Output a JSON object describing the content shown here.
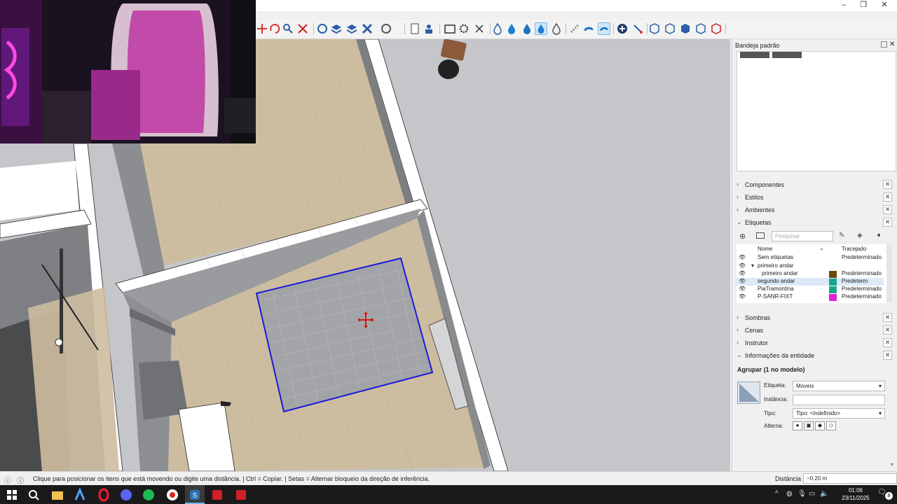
{
  "window": {
    "minimize": "–",
    "restore": "❐",
    "close": "✕"
  },
  "toolbar": {
    "icons": [
      "move-icon",
      "rotate-icon",
      "zoom-icon",
      "zoom-extents-icon",
      "section-icon",
      "layers-icon",
      "styles-icon",
      "scenes-icon",
      "geo-icon",
      "new-icon",
      "user-icon",
      "folder-icon",
      "gear-icon",
      "close-icon",
      "water-drop-icon",
      "water-drop-icon",
      "water-drop-icon",
      "water-drop-icon",
      "water-drop-icon",
      "magnet-icon",
      "magnet-icon",
      "magnet-icon",
      "add-icon",
      "connect-icon",
      "cube-icon",
      "cube-icon",
      "cube-icon",
      "cube-icon",
      "cube-icon",
      "cube-icon",
      "arrows-icon",
      "refresh-icon",
      "grid-icon",
      "grid-icon",
      "grid-icon"
    ]
  },
  "panel": {
    "title": "Bandeja padrão",
    "sections_top": [
      "Componentes",
      "Estilos",
      "Ambientes",
      "Etiquetas"
    ],
    "search_placeholder": "Pesquisar",
    "col_name": "Nome",
    "col_trace": "Tracejado",
    "tags": [
      {
        "name": "Sem etiquetas",
        "trace": "Predeterminado",
        "color": "",
        "indent": 0
      },
      {
        "name": "primeiro andar",
        "trace": "",
        "color": "",
        "indent": 1,
        "toggle": "▾"
      },
      {
        "name": "primeiro andar",
        "trace": "Predeterminado",
        "color": "#6b4a12",
        "indent": 2
      },
      {
        "name": "segundo andar",
        "trace": "Predeterm",
        "color": "#1aa58a",
        "indent": 0
      },
      {
        "name": "PiaTramontina",
        "trace": "Predeterminado",
        "color": "#1aa58a",
        "indent": 0
      },
      {
        "name": "P-SANR-FIXT",
        "trace": "Predeterminado",
        "color": "#e020d8",
        "indent": 0
      }
    ],
    "sections_bottom": [
      "Sombras",
      "Cenas",
      "Instrutor",
      "Informações da entidade"
    ],
    "entity": {
      "heading": "Agrupar (1 no modelo)",
      "tag_label": "Etiqueta:",
      "tag_value": "Moveis",
      "instance_label": "Instância:",
      "instance_value": "",
      "type_label": "Tipo:",
      "type_value": "Tipo: <indefinido>",
      "toggle_label": "Alterna:"
    }
  },
  "statusbar": {
    "message": "Clique para posicionar os itens que está movendo ou digite uma distância. | Ctrl = Copiar. | Setas = Alternar bloqueio da direção de inferência.",
    "measure_label": "Distância",
    "measure_value": "~0.20 m"
  },
  "taskbar": {
    "time": "01:06",
    "date": "23/11/2025",
    "notif_count": "8"
  }
}
